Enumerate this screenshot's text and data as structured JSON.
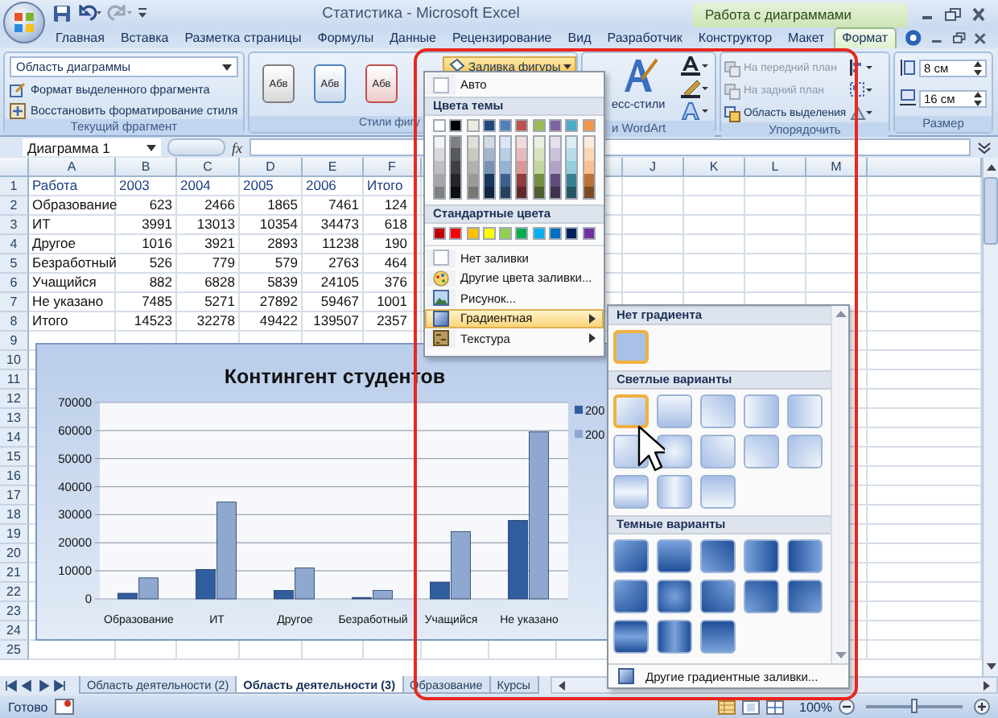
{
  "window": {
    "title": "Статистика - Microsoft Excel",
    "context_title": "Работа с диаграммами"
  },
  "ribbon_tabs": [
    {
      "label": "Главная",
      "selected": false
    },
    {
      "label": "Вставка",
      "selected": false
    },
    {
      "label": "Разметка страницы",
      "selected": false
    },
    {
      "label": "Формулы",
      "selected": false
    },
    {
      "label": "Данные",
      "selected": false
    },
    {
      "label": "Рецензирование",
      "selected": false
    },
    {
      "label": "Вид",
      "selected": false
    },
    {
      "label": "Разработчик",
      "selected": false
    },
    {
      "label": "Конструктор",
      "selected": false
    },
    {
      "label": "Макет",
      "selected": false
    },
    {
      "label": "Формат",
      "selected": true
    }
  ],
  "ribbon": {
    "current_selection": {
      "dropdown": "Область диаграммы",
      "buttons": [
        "Формат выделенного фрагмента",
        "Восстановить форматирование стиля"
      ],
      "label": "Текущий фрагмент"
    },
    "shape_styles": {
      "styles": [
        {
          "label": "Абв",
          "color": "#7f7f7f"
        },
        {
          "label": "Абв",
          "color": "#4f81bd"
        },
        {
          "label": "Абв",
          "color": "#c0504d"
        }
      ],
      "label": "Стили фигу"
    },
    "shape_fill_button": {
      "label": "Заливка фигуры",
      "expanded": true
    },
    "wordart": {
      "quick_styles": "есс-стили",
      "label": "и WordArt"
    },
    "arrange": {
      "items": [
        {
          "label": "На передний план",
          "disabled": true
        },
        {
          "label": "На задний план",
          "disabled": true
        },
        {
          "label": "Область выделения",
          "disabled": false
        }
      ],
      "label": "Упорядочить"
    },
    "size": {
      "height": "8 см",
      "width": "16 см",
      "label": "Размер"
    }
  },
  "formula_bar": {
    "name_box": "Диаграмма 1",
    "fx": "fx"
  },
  "sheet": {
    "columns_left": [
      "A",
      "B",
      "C",
      "D",
      "E",
      "F"
    ],
    "columns_right": [
      "J",
      "K",
      "L",
      "M"
    ],
    "rows": [
      {
        "number": "1",
        "kind": "header",
        "cells": [
          "Работа",
          "2003",
          "2004",
          "2005",
          "2006",
          "Итого"
        ]
      },
      {
        "number": "2",
        "kind": "data",
        "cells": [
          "Образование",
          "623",
          "2466",
          "1865",
          "7461",
          "124"
        ]
      },
      {
        "number": "3",
        "kind": "data",
        "cells": [
          "ИТ",
          "3991",
          "13013",
          "10354",
          "34473",
          "618"
        ]
      },
      {
        "number": "4",
        "kind": "data",
        "cells": [
          "Другое",
          "1016",
          "3921",
          "2893",
          "11238",
          "190"
        ]
      },
      {
        "number": "5",
        "kind": "data",
        "cells": [
          "Безработный",
          "526",
          "779",
          "579",
          "2763",
          "464"
        ]
      },
      {
        "number": "6",
        "kind": "data",
        "cells": [
          "Учащийся",
          "882",
          "6828",
          "5839",
          "24105",
          "376"
        ]
      },
      {
        "number": "7",
        "kind": "data",
        "cells": [
          "Не указано",
          "7485",
          "5271",
          "27892",
          "59467",
          "1001"
        ]
      },
      {
        "number": "8",
        "kind": "data",
        "cells": [
          "Итого",
          "14523",
          "32278",
          "49422",
          "139507",
          "2357"
        ]
      },
      {
        "number": "9"
      },
      {
        "number": "10"
      },
      {
        "number": "11"
      },
      {
        "number": "12"
      },
      {
        "number": "13"
      },
      {
        "number": "14"
      },
      {
        "number": "15"
      },
      {
        "number": "16"
      },
      {
        "number": "17"
      },
      {
        "number": "18"
      },
      {
        "number": "19"
      },
      {
        "number": "20"
      },
      {
        "number": "21"
      },
      {
        "number": "22"
      },
      {
        "number": "23"
      },
      {
        "number": "24"
      },
      {
        "number": "25"
      }
    ]
  },
  "chart": {
    "chart_data": {
      "type": "bar",
      "title": "Контингент студентов",
      "categories": [
        "Образование",
        "ИТ",
        "Другое",
        "Безработный",
        "Учащийся",
        "Не указано"
      ],
      "series": [
        {
          "name": "200",
          "color": "#2f5d9e",
          "values": [
            2000,
            10500,
            3000,
            500,
            6000,
            28000
          ]
        },
        {
          "name": "200",
          "color": "#8ea8cf",
          "values": [
            7500,
            34500,
            11000,
            3000,
            24000,
            59500
          ]
        }
      ],
      "grid": true,
      "ylim": [
        0,
        70000
      ],
      "yticks": [
        0,
        10000,
        20000,
        30000,
        40000,
        50000,
        60000,
        70000
      ]
    }
  },
  "fill_menu": {
    "auto": "Авто",
    "theme_header": "Цвета темы",
    "theme_colors": [
      {
        "color": "#ffffff"
      },
      {
        "color": "#000000"
      },
      {
        "color": "#eeece1"
      },
      {
        "color": "#1f497d"
      },
      {
        "color": "#4f81bd"
      },
      {
        "color": "#c0504d"
      },
      {
        "color": "#9bbb59"
      },
      {
        "color": "#8064a2"
      },
      {
        "color": "#4bacc6"
      },
      {
        "color": "#f79646"
      }
    ],
    "standard_header": "Стандартные цвета",
    "standard_colors": [
      {
        "color": "#c00000"
      },
      {
        "color": "#ff0000"
      },
      {
        "color": "#ffc000"
      },
      {
        "color": "#ffff00"
      },
      {
        "color": "#92d050"
      },
      {
        "color": "#00b050"
      },
      {
        "color": "#00b0f0"
      },
      {
        "color": "#0070c0"
      },
      {
        "color": "#002060"
      },
      {
        "color": "#7030a0"
      }
    ],
    "items": [
      {
        "label": "Нет заливки",
        "kind": "none",
        "selected": false,
        "submenu": false
      },
      {
        "label": "Другие цвета заливки...",
        "kind": "palette",
        "selected": false,
        "submenu": false
      },
      {
        "label": "Рисунок...",
        "kind": "picture",
        "selected": false,
        "submenu": false
      },
      {
        "label": "Градиентная",
        "kind": "gradient",
        "selected": true,
        "submenu": true
      },
      {
        "label": "Текстура",
        "kind": "texture",
        "selected": false,
        "submenu": true
      }
    ]
  },
  "gradient_menu": {
    "sections": [
      {
        "title": "Нет градиента",
        "kind": "none",
        "tiles": [
          {
            "kind": "flat",
            "selected": true
          }
        ]
      },
      {
        "title": "Светлые варианты",
        "kind": "light",
        "tiles": [
          {
            "kind": "diagdown",
            "selected": true
          },
          {
            "kind": "down",
            "selected": false
          },
          {
            "kind": "diagup",
            "selected": false
          },
          {
            "kind": "right",
            "selected": false
          },
          {
            "kind": "left",
            "selected": false
          },
          {
            "kind": "cornertl",
            "selected": false
          },
          {
            "kind": "center",
            "selected": false
          },
          {
            "kind": "cornertr",
            "selected": false
          },
          {
            "kind": "cornerbl",
            "selected": false
          },
          {
            "kind": "cornerbr",
            "selected": false
          },
          {
            "kind": "hcenter",
            "selected": false
          },
          {
            "kind": "vcenter",
            "selected": false
          },
          {
            "kind": "up",
            "selected": false
          }
        ]
      },
      {
        "title": "Темные варианты",
        "kind": "dark",
        "tiles": [
          {
            "kind": "diagdown",
            "selected": false
          },
          {
            "kind": "down",
            "selected": false
          },
          {
            "kind": "diagup",
            "selected": false
          },
          {
            "kind": "right",
            "selected": false
          },
          {
            "kind": "left",
            "selected": false
          },
          {
            "kind": "cornertl",
            "selected": false
          },
          {
            "kind": "center",
            "selected": false
          },
          {
            "kind": "cornertr",
            "selected": false
          },
          {
            "kind": "cornerbl",
            "selected": false
          },
          {
            "kind": "cornerbr",
            "selected": false
          },
          {
            "kind": "hcenter",
            "selected": false
          },
          {
            "kind": "vcenter",
            "selected": false
          },
          {
            "kind": "up",
            "selected": false
          }
        ]
      }
    ],
    "more": "Другие градиентные заливки..."
  },
  "sheet_tabs": [
    {
      "label": "Область деятельности (2)",
      "selected": false
    },
    {
      "label": "Область деятельности (3)",
      "selected": true
    },
    {
      "label": "Образование",
      "selected": false
    },
    {
      "label": "Курсы",
      "selected": false
    }
  ],
  "status_bar": {
    "text": "Готово",
    "zoom": {
      "reading": "100%",
      "level": 0.5
    }
  }
}
